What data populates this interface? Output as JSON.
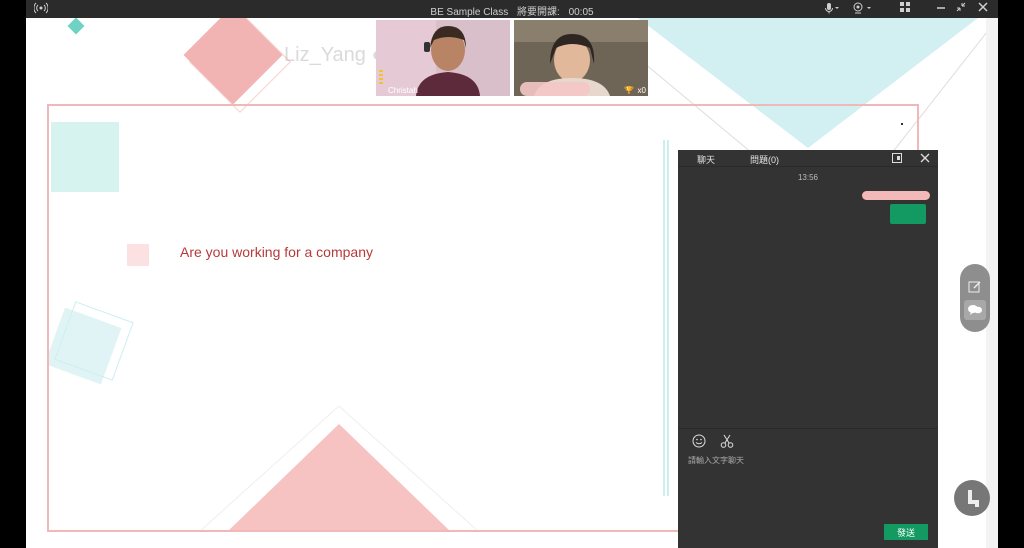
{
  "titlebar": {
    "class_name": "BE Sample Class",
    "countdown_label": "將要開課:",
    "countdown_value": "00:05"
  },
  "watermark": {
    "text": "Liz_Yang   ●   886-971673"
  },
  "videos": [
    {
      "name": "Christah"
    },
    {
      "name": "",
      "trophy_count": "x0"
    }
  ],
  "slide": {
    "text": "Are you working for a company"
  },
  "chat": {
    "tab_chat": "聊天",
    "tab_questions": "問題(0)",
    "timestamp": "13:56",
    "input_placeholder": "請輸入文字聊天",
    "send_label": "發送"
  },
  "icons": {
    "broadcast": "broadcast-icon",
    "mic": "microphone-icon",
    "camera": "camera-icon",
    "layout": "grid-layout-icon",
    "minimize": "minimize-icon",
    "restore": "restore-icon",
    "close": "close-icon",
    "emoji": "emoji-icon",
    "scissors": "scissors-icon",
    "detach": "detach-panel-icon",
    "edit": "edit-icon",
    "chat": "chat-bubbles-icon",
    "profile": "person-seated-icon"
  },
  "colors": {
    "accent_green": "#139a62",
    "slide_text": "#b73a3a",
    "slide_border": "#f0b8b8",
    "chat_bg": "#333333"
  }
}
